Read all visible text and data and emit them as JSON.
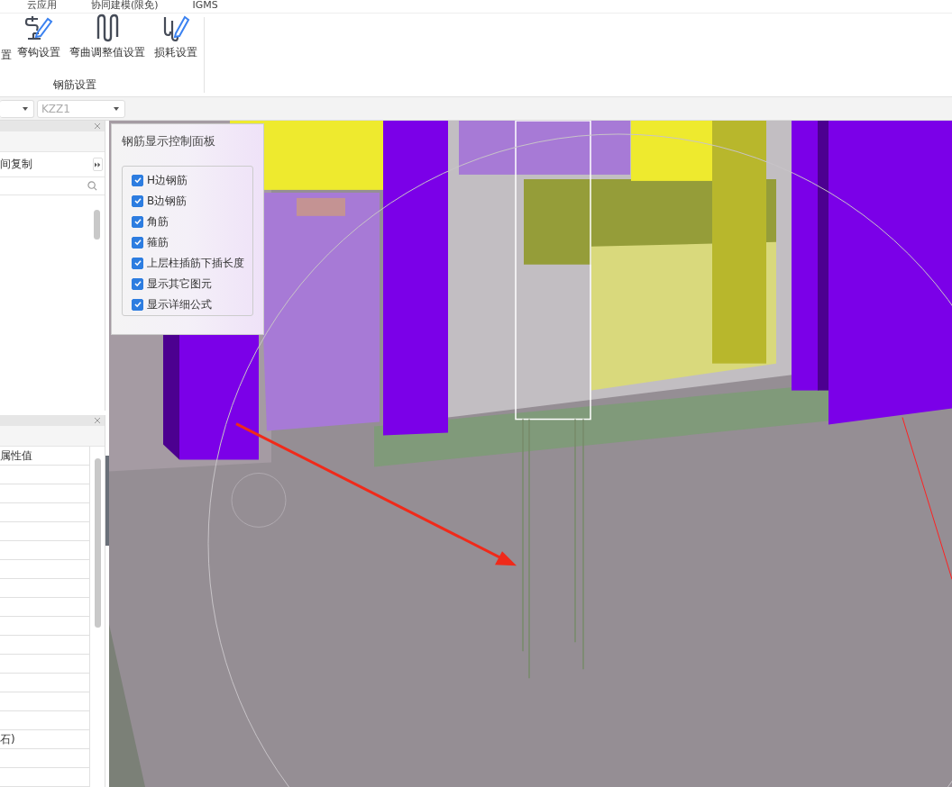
{
  "ribbon": {
    "menu_tabs": [
      "云应用",
      "协同建模(限免)",
      "IGMS"
    ],
    "tools": [
      {
        "label": "置"
      },
      {
        "label": "弯钩设置"
      },
      {
        "label": "弯曲调整值设置"
      },
      {
        "label": "损耗设置"
      }
    ],
    "group_label": "钢筋设置"
  },
  "toolbar": {
    "selector_value": "KZZ1"
  },
  "left_panel": {
    "copy_label": "间复制",
    "properties_header": "属性值",
    "cut_value": "石)"
  },
  "rebar_panel": {
    "title": "钢筋显示控制面板",
    "options": [
      {
        "label": "H边钢筋",
        "checked": true
      },
      {
        "label": "B边钢筋",
        "checked": true
      },
      {
        "label": "角筋",
        "checked": true
      },
      {
        "label": "箍筋",
        "checked": true
      },
      {
        "label": "上层柱插筋下插长度",
        "checked": true
      },
      {
        "label": "显示其它图元",
        "checked": true
      },
      {
        "label": "显示详细公式",
        "checked": true
      }
    ]
  }
}
